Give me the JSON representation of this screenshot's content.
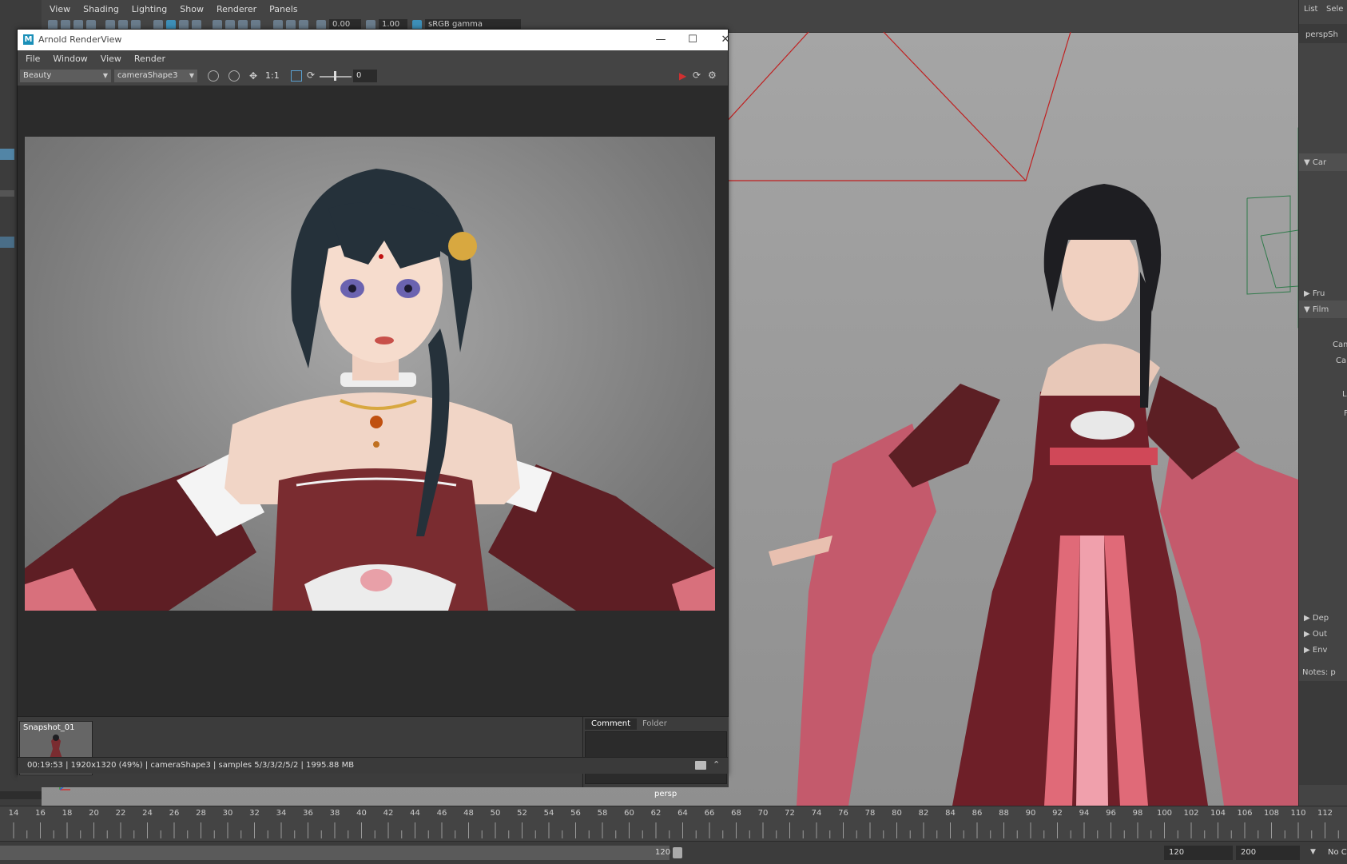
{
  "viewport": {
    "menu": [
      "View",
      "Shading",
      "Lighting",
      "Show",
      "Renderer",
      "Panels"
    ],
    "toolbar": {
      "exposure_value": "0.00",
      "gamma_value": "1.00",
      "color_space": "sRGB gamma"
    },
    "camera_label": "persp"
  },
  "render_view": {
    "title": "Arnold RenderView",
    "logo_letter": "M",
    "window_buttons": {
      "minimize": "—",
      "maximize": "☐",
      "close": "✕"
    },
    "menu": [
      "File",
      "Window",
      "View",
      "Render"
    ],
    "toolbar": {
      "aov": "Beauty",
      "camera": "cameraShape3",
      "ratio": "1:1",
      "exposure_value": "0"
    },
    "snapshot": {
      "label": "Snapshot_01"
    },
    "tabs": [
      "Comment",
      "Folder"
    ],
    "status": "00:19:53 | 1920x1320 (49%) | cameraShape3  | samples 5/3/3/2/5/2 | 1995.88 MB"
  },
  "right_panel": {
    "top_menu": [
      "List",
      "Sele"
    ],
    "node_field": "perspSh",
    "sections": [
      "Car",
      "Fru",
      "Film",
      "Dep",
      "Out",
      "Env"
    ],
    "labels": [
      "Cam",
      "Car",
      "L",
      "F"
    ],
    "notes_label": "Notes: p"
  },
  "timeline": {
    "ticks": [
      "14",
      "16",
      "18",
      "20",
      "22",
      "24",
      "26",
      "28",
      "30",
      "32",
      "34",
      "36",
      "38",
      "40",
      "42",
      "44",
      "46",
      "48",
      "50",
      "52",
      "54",
      "56",
      "58",
      "60",
      "62",
      "64",
      "66",
      "68",
      "70",
      "72",
      "74",
      "76",
      "78",
      "80",
      "82",
      "84",
      "86",
      "88",
      "90",
      "92",
      "94",
      "96",
      "98",
      "100",
      "102",
      "104",
      "106",
      "108",
      "110",
      "112"
    ]
  },
  "range": {
    "current_end": "120",
    "end": "120",
    "max": "200",
    "char_set": "No C"
  },
  "colors": {
    "accent_blue": "#5285a6",
    "render_red_button": "#d03030"
  }
}
